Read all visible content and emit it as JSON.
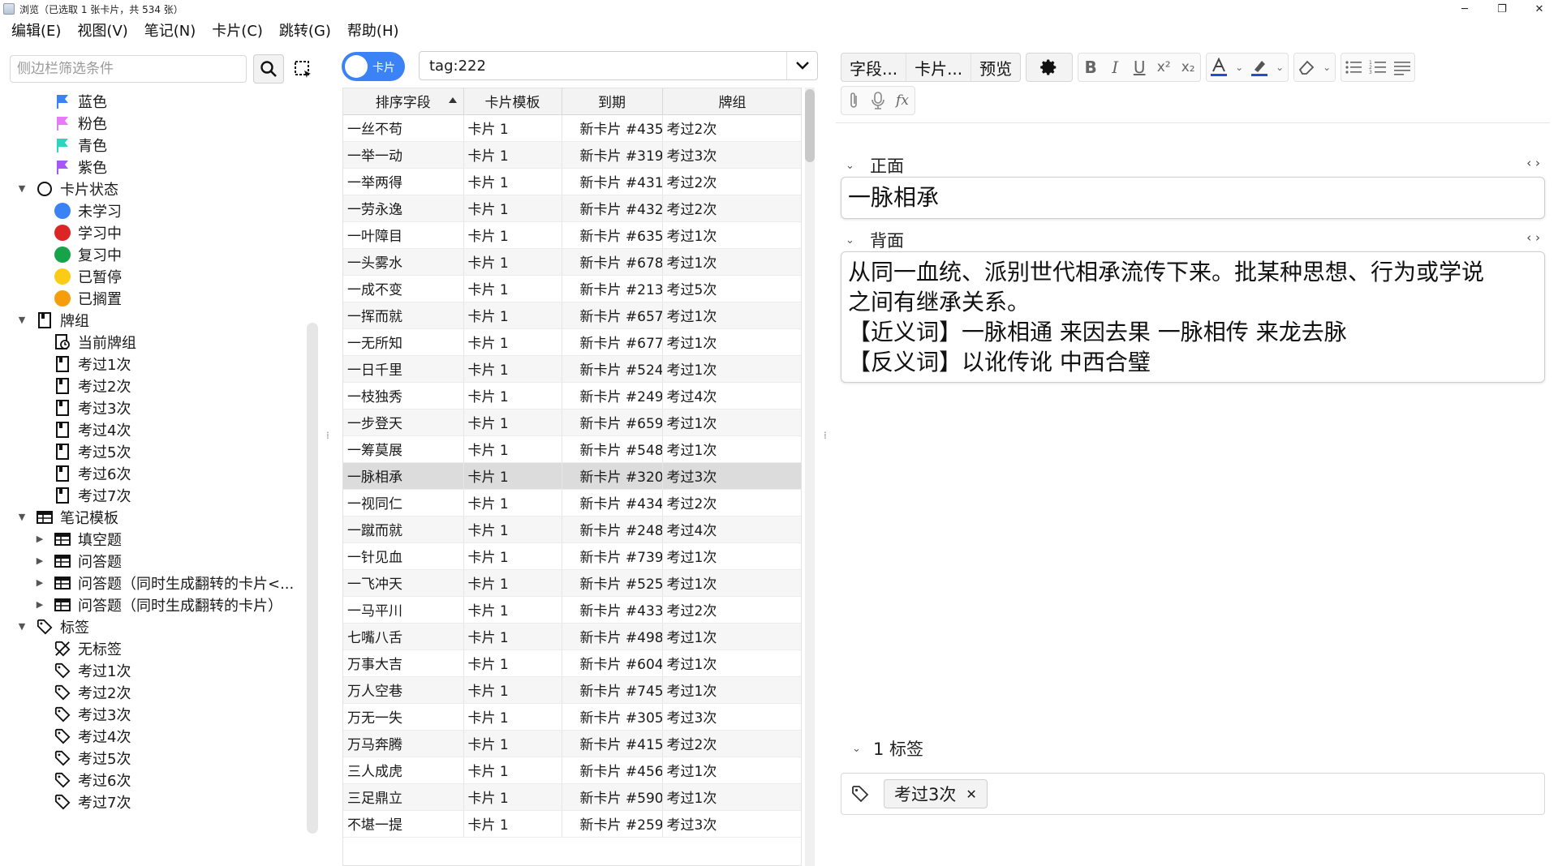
{
  "window": {
    "title": "浏览（已选取 1 张卡片，共 534 张）"
  },
  "menu": [
    "编辑(E)",
    "视图(V)",
    "笔记(N)",
    "卡片(C)",
    "跳转(G)",
    "帮助(H)"
  ],
  "sidebar": {
    "search_placeholder": "侧边栏筛选条件",
    "items": [
      {
        "label": "蓝色",
        "indent": 2,
        "icon": "flag-icon",
        "color": "#3b82f6"
      },
      {
        "label": "粉色",
        "indent": 2,
        "icon": "flag-icon",
        "color": "#e879f9"
      },
      {
        "label": "青色",
        "indent": 2,
        "icon": "flag-icon",
        "color": "#2dd4bf"
      },
      {
        "label": "紫色",
        "indent": 2,
        "icon": "flag-icon",
        "color": "#a855f7"
      },
      {
        "label": "卡片状态",
        "indent": 1,
        "icon": "circle-icon",
        "caret": "▼"
      },
      {
        "label": "未学习",
        "indent": 2,
        "icon": "dot-icon",
        "color": "#3b82f6"
      },
      {
        "label": "学习中",
        "indent": 2,
        "icon": "dot-icon",
        "color": "#dc2626"
      },
      {
        "label": "复习中",
        "indent": 2,
        "icon": "dot-icon",
        "color": "#16a34a"
      },
      {
        "label": "已暂停",
        "indent": 2,
        "icon": "dot-icon",
        "color": "#facc15"
      },
      {
        "label": "已搁置",
        "indent": 2,
        "icon": "dot-icon",
        "color": "#f59e0b"
      },
      {
        "label": "牌组",
        "indent": 1,
        "icon": "deck-icon",
        "caret": "▼"
      },
      {
        "label": "当前牌组",
        "indent": 2,
        "icon": "current-deck-icon"
      },
      {
        "label": "考过1次",
        "indent": 2,
        "icon": "deck-icon"
      },
      {
        "label": "考过2次",
        "indent": 2,
        "icon": "deck-icon"
      },
      {
        "label": "考过3次",
        "indent": 2,
        "icon": "deck-icon"
      },
      {
        "label": "考过4次",
        "indent": 2,
        "icon": "deck-icon"
      },
      {
        "label": "考过5次",
        "indent": 2,
        "icon": "deck-icon"
      },
      {
        "label": "考过6次",
        "indent": 2,
        "icon": "deck-icon"
      },
      {
        "label": "考过7次",
        "indent": 2,
        "icon": "deck-icon"
      },
      {
        "label": "笔记模板",
        "indent": 1,
        "icon": "notetype-icon",
        "caret": "▼"
      },
      {
        "label": "填空题",
        "indent": 2,
        "icon": "notetype-icon",
        "caret": "▶"
      },
      {
        "label": "问答题",
        "indent": 2,
        "icon": "notetype-icon",
        "caret": "▶"
      },
      {
        "label": "问答题（同时生成翻转的卡片<...",
        "indent": 2,
        "icon": "notetype-icon",
        "caret": "▶"
      },
      {
        "label": "问答题（同时生成翻转的卡片）",
        "indent": 2,
        "icon": "notetype-icon",
        "caret": "▶"
      },
      {
        "label": "标签",
        "indent": 1,
        "icon": "tag-icon",
        "caret": "▼"
      },
      {
        "label": "无标签",
        "indent": 2,
        "icon": "no-tag-icon"
      },
      {
        "label": "考过1次",
        "indent": 2,
        "icon": "tag-icon"
      },
      {
        "label": "考过2次",
        "indent": 2,
        "icon": "tag-icon"
      },
      {
        "label": "考过3次",
        "indent": 2,
        "icon": "tag-icon"
      },
      {
        "label": "考过4次",
        "indent": 2,
        "icon": "tag-icon"
      },
      {
        "label": "考过5次",
        "indent": 2,
        "icon": "tag-icon"
      },
      {
        "label": "考过6次",
        "indent": 2,
        "icon": "tag-icon"
      },
      {
        "label": "考过7次",
        "indent": 2,
        "icon": "tag-icon"
      }
    ]
  },
  "browser": {
    "toggle_label": "卡片",
    "query": "tag:222",
    "columns": [
      "排序字段",
      "卡片模板",
      "到期",
      "牌组"
    ],
    "selected_index": 13,
    "rows": [
      [
        "一丝不苟",
        "卡片 1",
        "新卡片 #435",
        "考过2次"
      ],
      [
        "一举一动",
        "卡片 1",
        "新卡片 #319",
        "考过3次"
      ],
      [
        "一举两得",
        "卡片 1",
        "新卡片 #431",
        "考过2次"
      ],
      [
        "一劳永逸",
        "卡片 1",
        "新卡片 #432",
        "考过2次"
      ],
      [
        "一叶障目",
        "卡片 1",
        "新卡片 #635",
        "考过1次"
      ],
      [
        "一头雾水",
        "卡片 1",
        "新卡片 #678",
        "考过1次"
      ],
      [
        "一成不变",
        "卡片 1",
        "新卡片 #213",
        "考过5次"
      ],
      [
        "一挥而就",
        "卡片 1",
        "新卡片 #657",
        "考过1次"
      ],
      [
        "一无所知",
        "卡片 1",
        "新卡片 #677",
        "考过1次"
      ],
      [
        "一日千里",
        "卡片 1",
        "新卡片 #524",
        "考过1次"
      ],
      [
        "一枝独秀",
        "卡片 1",
        "新卡片 #249",
        "考过4次"
      ],
      [
        "一步登天",
        "卡片 1",
        "新卡片 #659",
        "考过1次"
      ],
      [
        "一筹莫展",
        "卡片 1",
        "新卡片 #548",
        "考过1次"
      ],
      [
        "一脉相承",
        "卡片 1",
        "新卡片 #320",
        "考过3次"
      ],
      [
        "一视同仁",
        "卡片 1",
        "新卡片 #434",
        "考过2次"
      ],
      [
        "一蹴而就",
        "卡片 1",
        "新卡片 #248",
        "考过4次"
      ],
      [
        "一针见血",
        "卡片 1",
        "新卡片 #739",
        "考过1次"
      ],
      [
        "一飞冲天",
        "卡片 1",
        "新卡片 #525",
        "考过1次"
      ],
      [
        "一马平川",
        "卡片 1",
        "新卡片 #433",
        "考过2次"
      ],
      [
        "七嘴八舌",
        "卡片 1",
        "新卡片 #498",
        "考过1次"
      ],
      [
        "万事大吉",
        "卡片 1",
        "新卡片 #604",
        "考过1次"
      ],
      [
        "万人空巷",
        "卡片 1",
        "新卡片 #745",
        "考过1次"
      ],
      [
        "万无一失",
        "卡片 1",
        "新卡片 #305",
        "考过3次"
      ],
      [
        "万马奔腾",
        "卡片 1",
        "新卡片 #415",
        "考过2次"
      ],
      [
        "三人成虎",
        "卡片 1",
        "新卡片 #456",
        "考过1次"
      ],
      [
        "三足鼎立",
        "卡片 1",
        "新卡片 #590",
        "考过1次"
      ],
      [
        "不堪一提",
        "卡片 1",
        "新卡片 #259",
        "考过3次"
      ]
    ]
  },
  "editor": {
    "toolbar": {
      "fields": "字段...",
      "cards": "卡片...",
      "preview": "预览"
    },
    "front_label": "正面",
    "front_value": "一脉相承",
    "back_label": "背面",
    "back_lines": [
      "从同一血统、派别世代相承流传下来。批某种思想、行为或学说",
      "之间有继承关系。",
      "【近义词】一脉相通 来因去果 一脉相传 来龙去脉",
      "【反义词】以讹传讹 中西合璧"
    ],
    "tags_label": "1 标签",
    "tags": [
      "考过3次"
    ],
    "colors": {
      "text_color": "#1d4ed8",
      "highlight_color": "#1d4ed8"
    }
  }
}
